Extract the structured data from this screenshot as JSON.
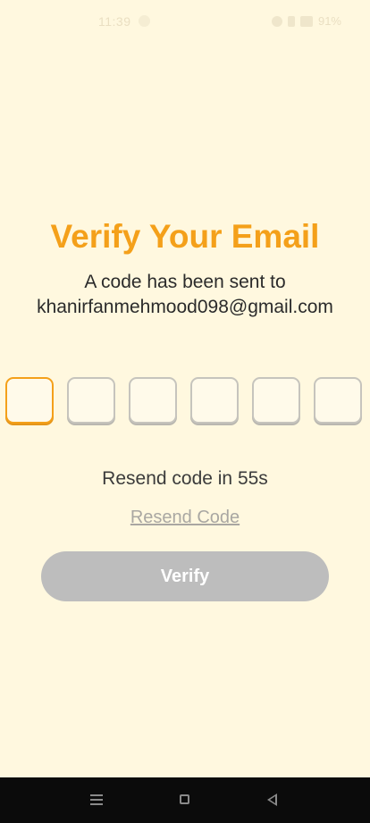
{
  "status_bar": {
    "time": "11:39",
    "battery": "91%"
  },
  "title": "Verify Your Email",
  "subtitle": {
    "line1": "A code has been sent to",
    "email": "khanirfanmehmood098@gmail.com"
  },
  "code_boxes": [
    "",
    "",
    "",
    "",
    "",
    ""
  ],
  "countdown": "Resend code in 55s",
  "resend_label": "Resend Code",
  "verify_label": "Verify",
  "colors": {
    "background": "#fff8df",
    "accent": "#f4a01a",
    "button_disabled": "#bdbdbd",
    "link_disabled": "#a9a7a2"
  },
  "icons": {
    "nav": [
      "menu-icon",
      "home-icon",
      "back-icon"
    ]
  }
}
